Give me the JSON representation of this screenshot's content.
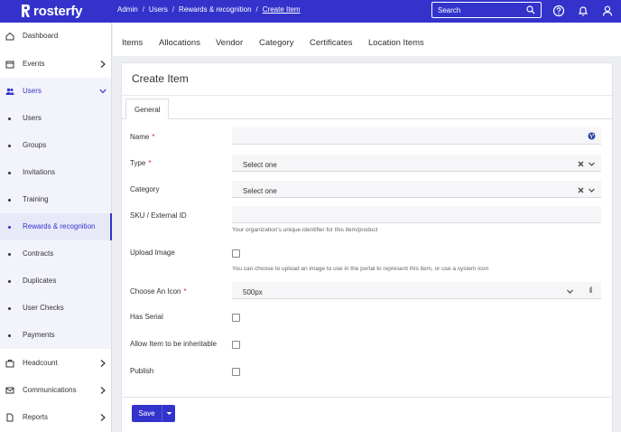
{
  "app": {
    "logo_text": "rosterfy"
  },
  "breadcrumb": {
    "items": [
      "Admin",
      "Users",
      "Rewards & recognition"
    ],
    "current": "Create Item",
    "separator": "/"
  },
  "search": {
    "placeholder": "Search"
  },
  "topbar_icons": [
    "help-icon",
    "bell-icon",
    "user-icon"
  ],
  "sidebar": {
    "items": [
      {
        "label": "Dashboard",
        "icon": "home-icon"
      },
      {
        "label": "Events",
        "icon": "calendar-icon"
      },
      {
        "label": "Users",
        "icon": "users-icon"
      },
      {
        "label": "Users"
      },
      {
        "label": "Groups"
      },
      {
        "label": "Invitations"
      },
      {
        "label": "Training"
      },
      {
        "label": "Rewards & recognition"
      },
      {
        "label": "Contracts"
      },
      {
        "label": "Duplicates"
      },
      {
        "label": "User Checks"
      },
      {
        "label": "Payments"
      },
      {
        "label": "Headcount",
        "icon": "briefcase-icon"
      },
      {
        "label": "Communications",
        "icon": "mail-icon"
      },
      {
        "label": "Reports",
        "icon": "document-icon"
      }
    ]
  },
  "tabs": [
    "Items",
    "Allocations",
    "Vendor",
    "Category",
    "Certificates",
    "Location Items"
  ],
  "card": {
    "title": "Create Item",
    "section_tab": "General"
  },
  "form": {
    "name": {
      "label": "Name",
      "required": "*",
      "value": ""
    },
    "type": {
      "label": "Type",
      "required": "*",
      "value": "Select one"
    },
    "category": {
      "label": "Category",
      "value": "Select one"
    },
    "sku": {
      "label": "SKU / External ID",
      "value": "",
      "hint": "Your organization's unique identifier for this item/product"
    },
    "upload_image": {
      "label": "Upload Image",
      "hint": "You can choose to upload an image to use in the portal to represent this item, or use a system icon"
    },
    "icon": {
      "label": "Choose An Icon",
      "required": "*",
      "value": "500px"
    },
    "has_serial": {
      "label": "Has Serial"
    },
    "inheritable": {
      "label": "Allow Item to be inheritable"
    },
    "publish": {
      "label": "Publish"
    }
  },
  "footer": {
    "save_label": "Save"
  },
  "colors": {
    "brand": "#3333cc",
    "required": "#e02020"
  }
}
